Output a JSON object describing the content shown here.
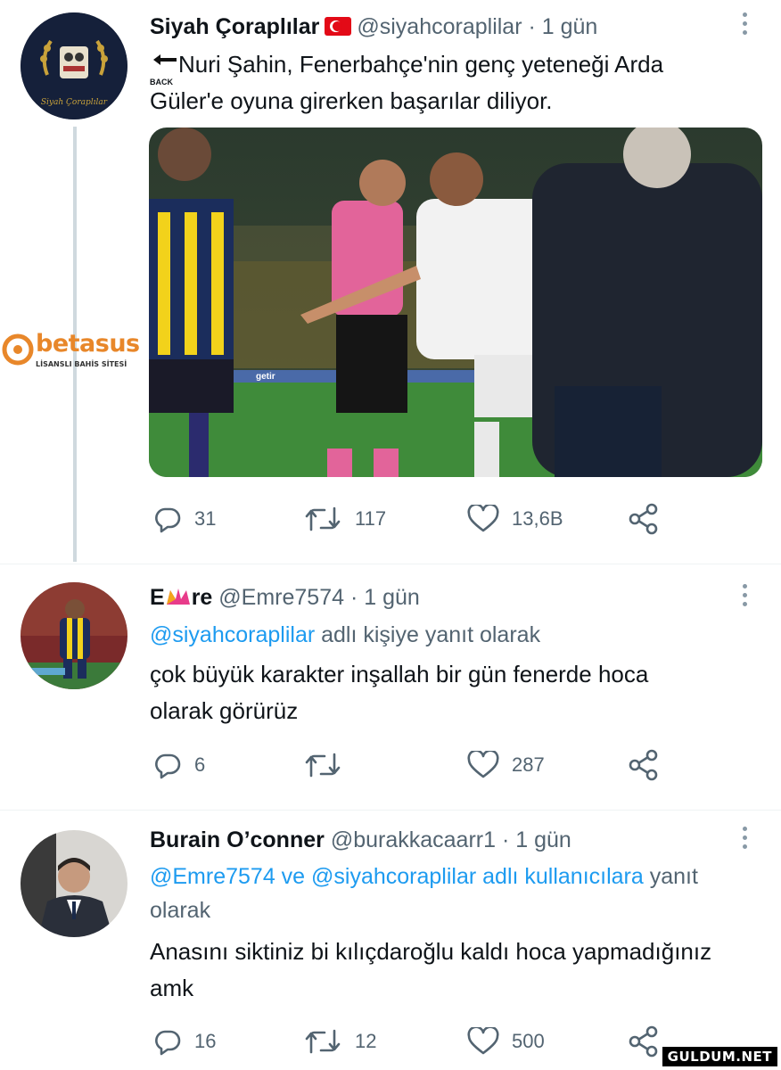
{
  "watermark_left": {
    "brand": "betasus",
    "tagline": "LİSANSLI BAHİS SİTESİ"
  },
  "watermark_right": "GULDUM.NET",
  "tweets": [
    {
      "name": "Siyah Çoraplılar",
      "handle": "@siyahcoraplilar",
      "time": "· 1 gün",
      "back_label": "BACK",
      "text_line1": "Nuri Şahin, Fenerbahçe'nin genç yeteneği Arda",
      "text_line2": "Güler'e oyuna girerken başarılar diliyor.",
      "avatar_caption": "Siyah Çoraplılar",
      "photo_banner": "getir",
      "replies": "31",
      "retweets": "117",
      "likes": "13,6B"
    },
    {
      "name": "E",
      "name_rest": "re",
      "handle": "@Emre7574",
      "time": "· 1 gün",
      "reply_to_user": "@siyahcoraplilar",
      "reply_to_suffix": " adlı kişiye yanıt olarak",
      "text_line1": "çok büyük karakter inşallah bir gün fenerde hoca",
      "text_line2": "olarak görürüz",
      "replies": "6",
      "retweets": "",
      "likes": "287"
    },
    {
      "name": "Burain O’conner",
      "handle": "@burakkacaarr1",
      "time": "· 1 gün",
      "reply_to_line1": "@Emre7574 ve @siyahcoraplilar adlı kullanıcılara",
      "reply_to_word": "yanıt",
      "reply_to_line2": "olarak",
      "text_line1": "Anasını siktiniz bi kılıçdaroğlu kaldı hoca yapmadığınız",
      "text_line2": "amk",
      "replies": "16",
      "retweets": "12",
      "likes": "500"
    }
  ],
  "colors": {
    "link": "#1d9bf0",
    "muted": "#536471",
    "thread": "#cfd9de"
  },
  "icons": [
    "reply-icon",
    "retweet-icon",
    "like-icon",
    "share-icon",
    "more-icon",
    "back-arrow-icon",
    "turkey-flag-icon"
  ]
}
